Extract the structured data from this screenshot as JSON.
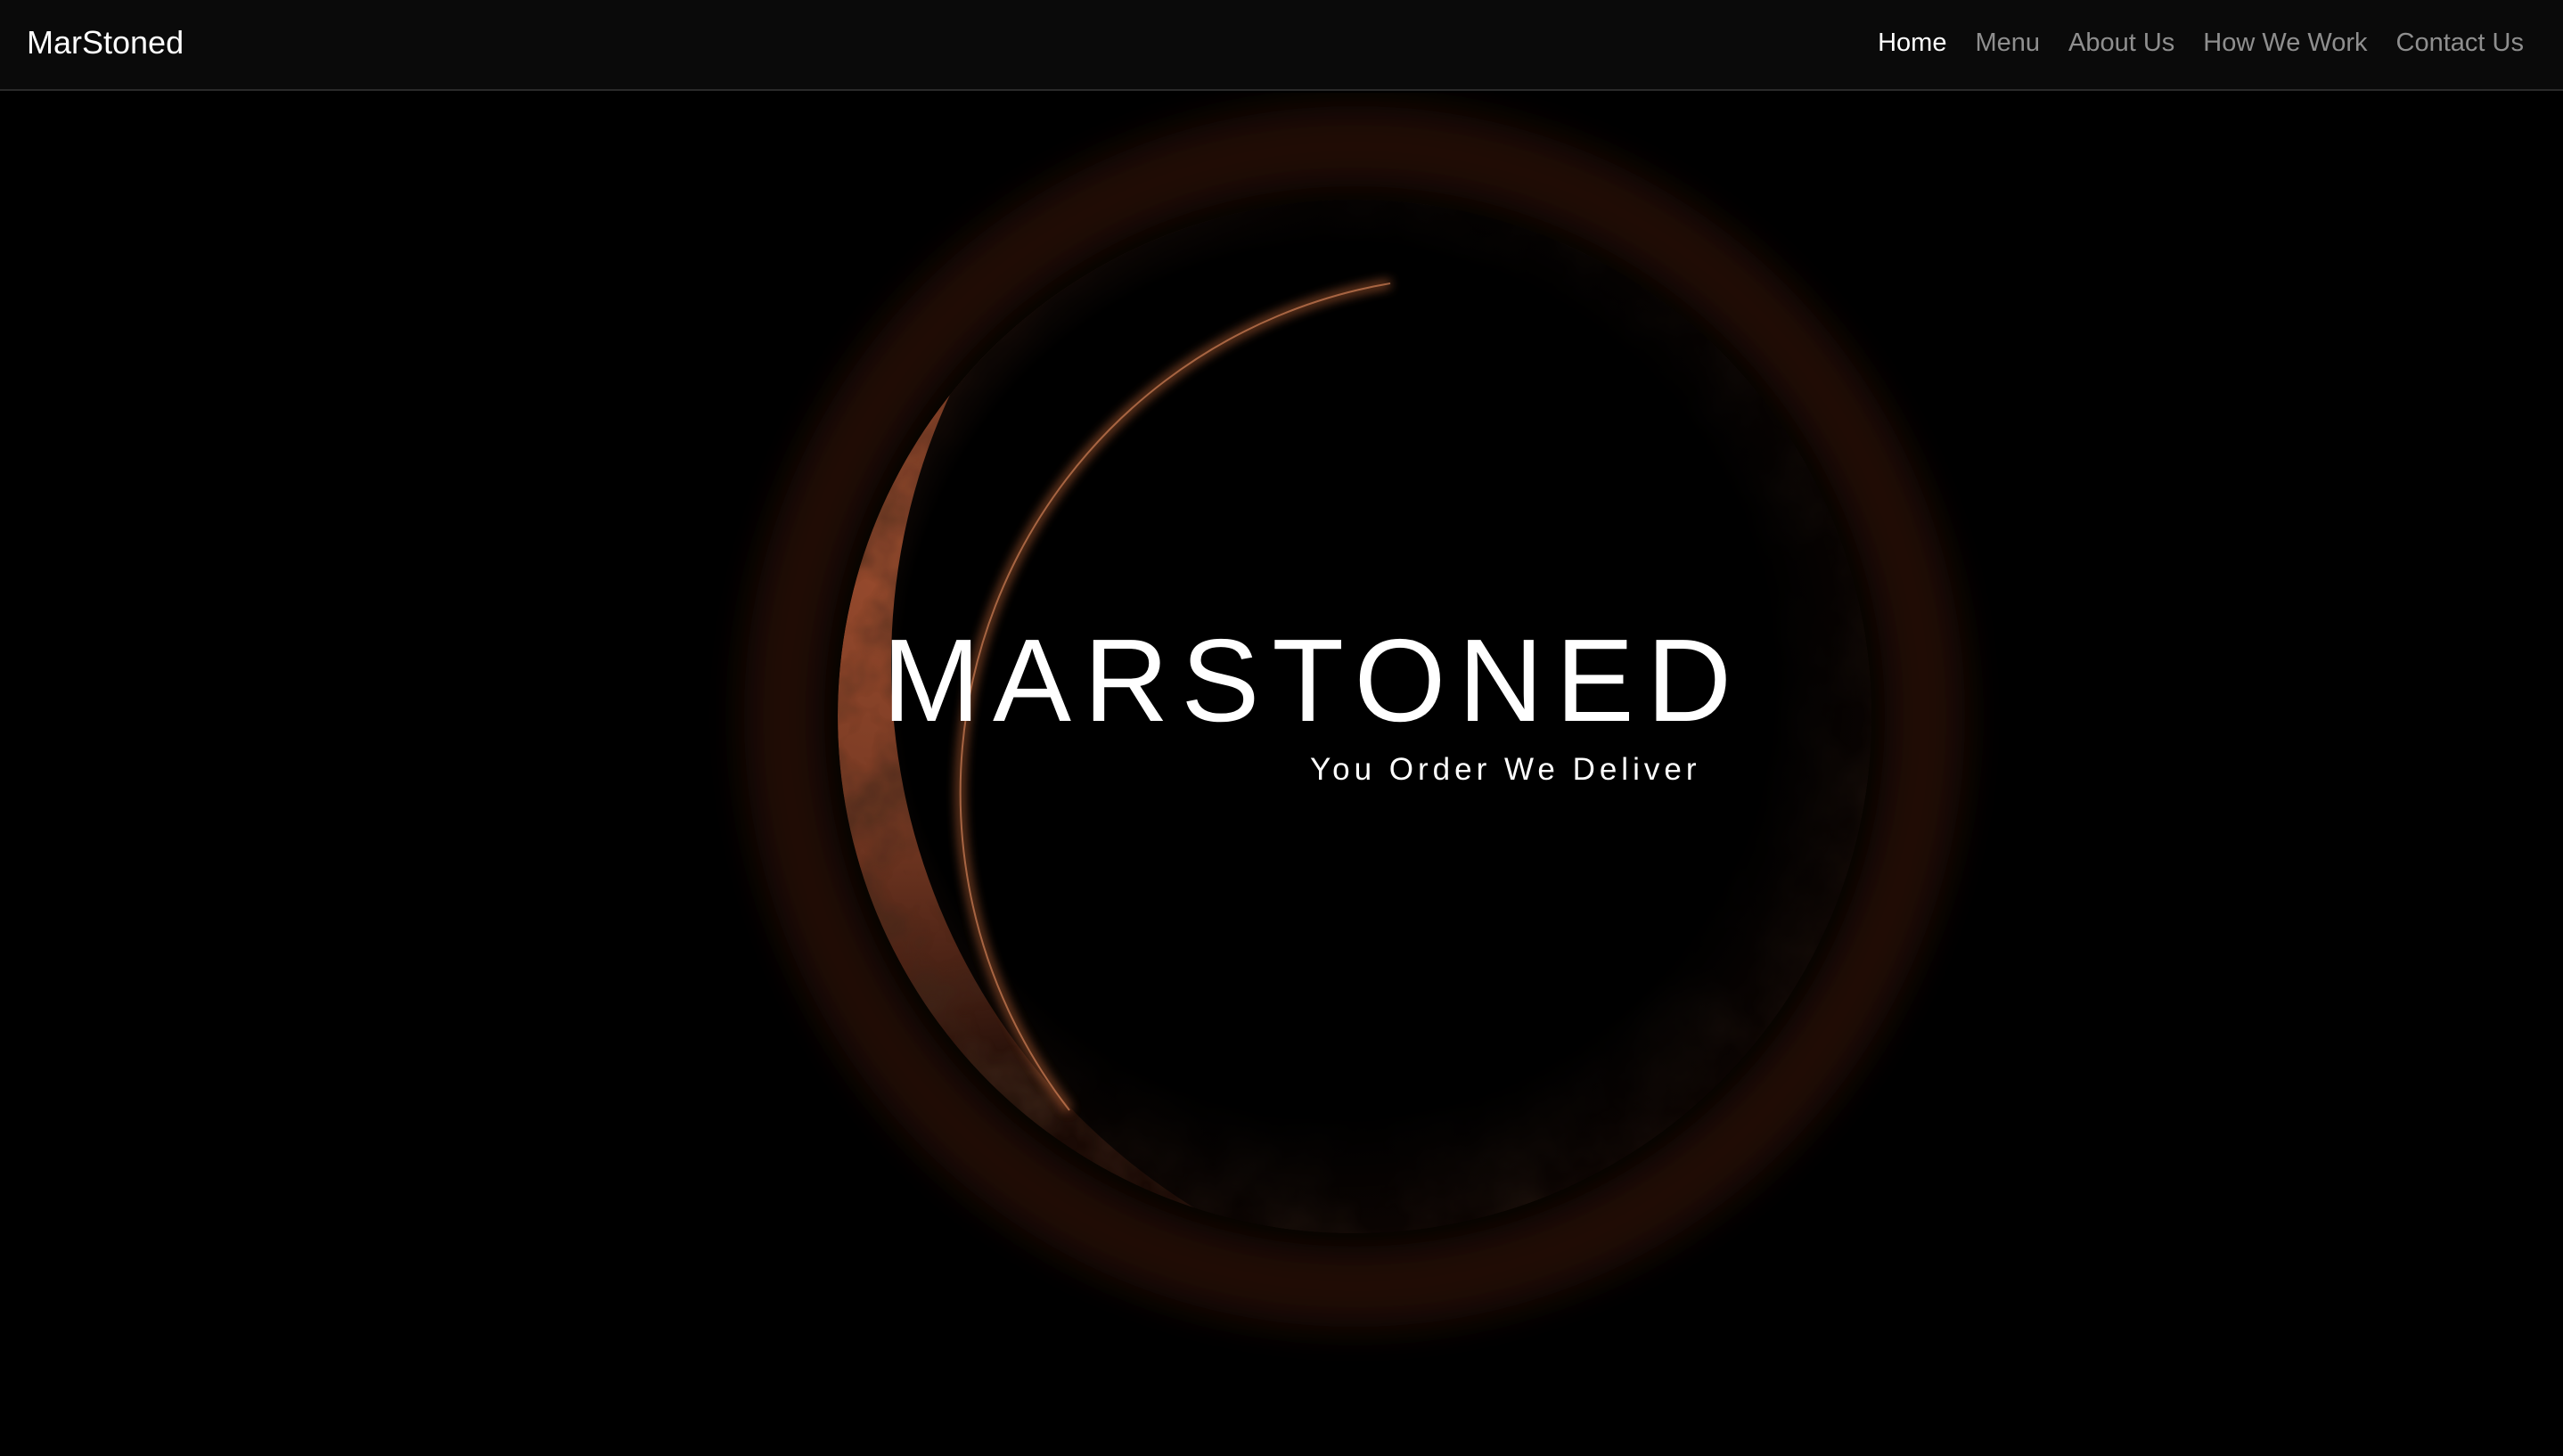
{
  "navbar": {
    "brand": "MarStoned",
    "links": [
      {
        "label": "Home",
        "active": true
      },
      {
        "label": "Menu",
        "active": false
      },
      {
        "label": "About Us",
        "active": false
      },
      {
        "label": "How We Work",
        "active": false
      },
      {
        "label": "Contact Us",
        "active": false
      }
    ]
  },
  "hero": {
    "title": "MARSTONED",
    "subtitle": "You Order We Deliver",
    "background_image": "mars-crescent-planet"
  },
  "colors": {
    "background": "#000000",
    "navbar_background": "#0a0a0a",
    "nav_link_inactive": "#8f8f8f",
    "nav_link_active": "#ffffff",
    "mars_rim": "#c0613a",
    "mars_surface": "#6e3a26"
  }
}
